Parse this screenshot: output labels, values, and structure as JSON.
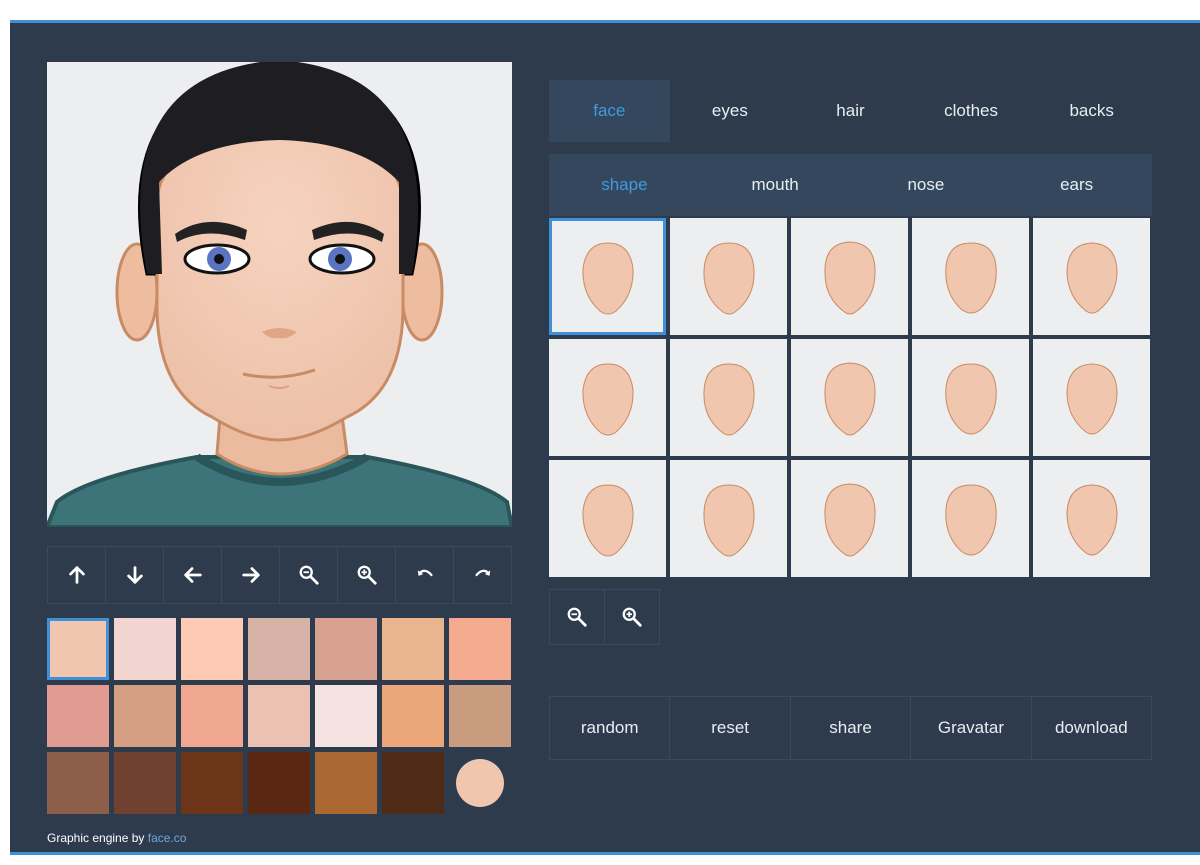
{
  "main_tabs": [
    {
      "label": "face",
      "active": true
    },
    {
      "label": "eyes",
      "active": false
    },
    {
      "label": "hair",
      "active": false
    },
    {
      "label": "clothes",
      "active": false
    },
    {
      "label": "backs",
      "active": false
    }
  ],
  "sub_tabs": [
    {
      "label": "shape",
      "active": true
    },
    {
      "label": "mouth",
      "active": false
    },
    {
      "label": "nose",
      "active": false
    },
    {
      "label": "ears",
      "active": false
    }
  ],
  "toolbar": [
    {
      "icon": "arrow-up-icon",
      "name": "move-up-button"
    },
    {
      "icon": "arrow-down-icon",
      "name": "move-down-button"
    },
    {
      "icon": "arrow-left-icon",
      "name": "move-left-button"
    },
    {
      "icon": "arrow-right-icon",
      "name": "move-right-button"
    },
    {
      "icon": "zoom-out-icon",
      "name": "zoom-out-button"
    },
    {
      "icon": "zoom-in-icon",
      "name": "zoom-in-button"
    },
    {
      "icon": "undo-icon",
      "name": "undo-button"
    },
    {
      "icon": "redo-icon",
      "name": "redo-button"
    }
  ],
  "skin_colors": [
    "#f0c6ae",
    "#f2d5d0",
    "#fdcab4",
    "#d7b3a7",
    "#d8a190",
    "#e8b58f",
    "#f4aa8e",
    "#e09c93",
    "#d49f83",
    "#f0a891",
    "#ebc1b3",
    "#f5e3e2",
    "#eba67a",
    "#c99c80",
    "#8d5e4a",
    "#6f412e",
    "#6d3517",
    "#5a2812",
    "#ab6832",
    "#4e2b16",
    "#f0c6ae"
  ],
  "selected_swatch_index": 0,
  "shape_count": 15,
  "selected_shape_index": 0,
  "shape_zoom": [
    {
      "icon": "zoom-out-icon",
      "name": "shape-zoom-out-button"
    },
    {
      "icon": "zoom-in-icon",
      "name": "shape-zoom-in-button"
    }
  ],
  "actions": [
    "random",
    "reset",
    "share",
    "Gravatar",
    "download"
  ],
  "credit": {
    "text": "Graphic engine by ",
    "link": "face.co"
  },
  "colors": {
    "background": "#2d3b4d",
    "accent": "#3f90d6",
    "active_tab": "#34475d",
    "skin": "#f0c6ae",
    "skin_outline": "#c98b63",
    "hair": "#1e1e22",
    "shirt": "#3d7479"
  }
}
